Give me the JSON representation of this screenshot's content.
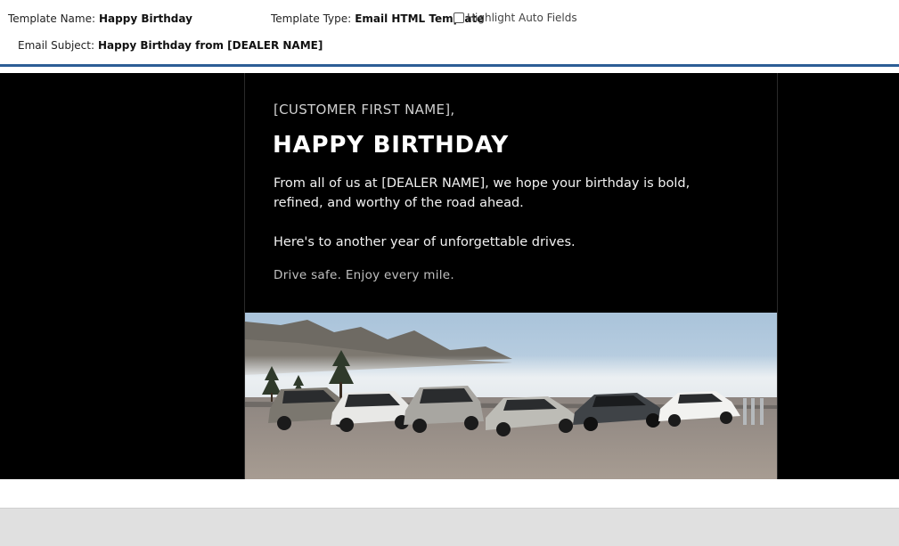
{
  "header": {
    "template_name_label": "Template Name:",
    "template_name_value": "Happy Birthday",
    "template_type_label": "Template Type:",
    "template_type_value": "Email HTML Template",
    "highlight_label": "Highlight Auto Fields",
    "highlight_checked": false,
    "email_subject_label": "Email Subject:",
    "email_subject_value": "Happy Birthday from [DEALER NAME]"
  },
  "email": {
    "greeting": "[CUSTOMER FIRST NAME],",
    "headline": "HAPPY BIRTHDAY",
    "paragraph1": "From all of us at [DEALER NAME], we hope your birthday is bold, refined, and worthy of the road ahead.",
    "paragraph2": "Here's to another year of unforgettable drives.",
    "signoff": "Drive safe. Enjoy every mile."
  },
  "colors": {
    "accent_divider": "#2c5d96",
    "email_background": "#000000",
    "page_footer": "#e0e0e0"
  }
}
